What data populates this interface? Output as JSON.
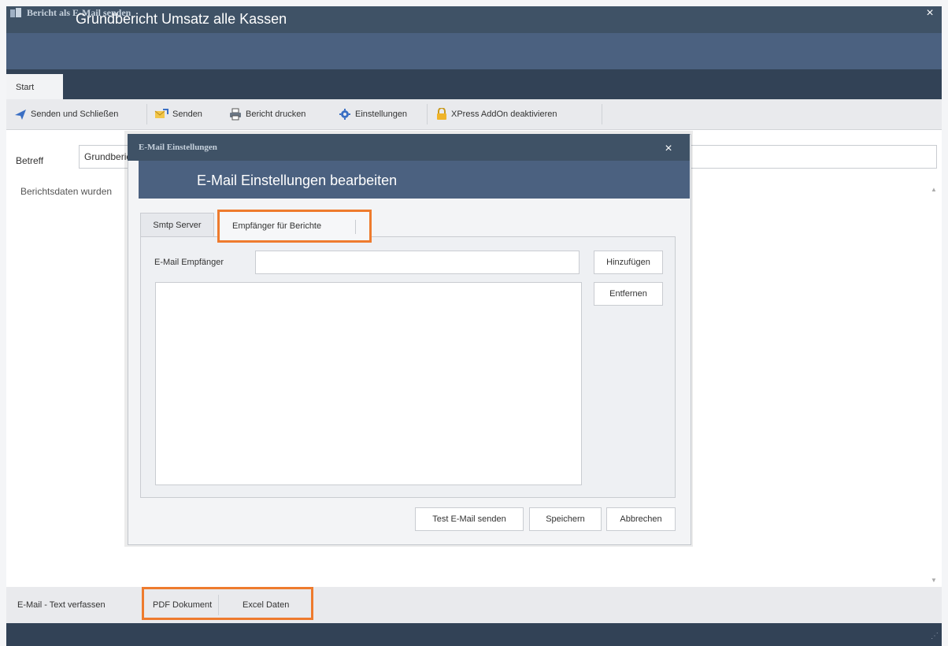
{
  "window": {
    "title": "Bericht als E-Mail senden",
    "close_glyph": "×",
    "header_title": "Grundbericht Umsatz alle Kassen"
  },
  "ribbon": {
    "tabs": [
      {
        "label": "Start"
      }
    ]
  },
  "toolbar": {
    "items": [
      {
        "label": "Senden und Schließen",
        "icon": "send-icon"
      },
      {
        "label": "Senden",
        "icon": "mail-send-icon"
      },
      {
        "label": "Bericht drucken",
        "icon": "printer-icon"
      },
      {
        "label": "Einstellungen",
        "icon": "gear-icon"
      },
      {
        "label": "XPress AddOn deaktivieren",
        "icon": "lock-icon"
      }
    ]
  },
  "mail": {
    "subject_label": "Betreff",
    "subject_value": "Grundbericht Umsatz alle Kassen",
    "body_text": "Berichtsdaten wurden"
  },
  "bottom_tabs": [
    {
      "label": "E-Mail - Text verfassen"
    },
    {
      "label": "PDF Dokument"
    },
    {
      "label": "Excel Daten"
    }
  ],
  "dialog": {
    "title": "E-Mail Einstellungen",
    "close_glyph": "×",
    "header_title": "E-Mail Einstellungen bearbeiten",
    "tabs": [
      {
        "label": "Smtp Server"
      },
      {
        "label": "Empfänger für Berichte"
      }
    ],
    "recipient_label": "E-Mail Empfänger",
    "recipient_value": "",
    "add_button": "Hinzufügen",
    "remove_button": "Entfernen",
    "test_button": "Test E-Mail senden",
    "save_button": "Speichern",
    "cancel_button": "Abbrechen"
  },
  "colors": {
    "accent_highlight": "#ee7b2e",
    "titlebar": "#3f5266",
    "header": "#4b6180"
  }
}
